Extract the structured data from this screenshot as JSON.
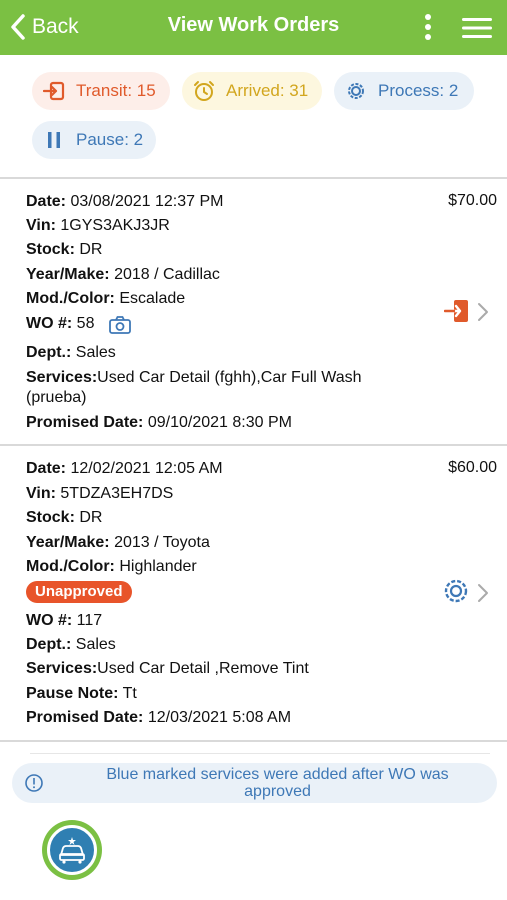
{
  "header": {
    "back_label": "Back",
    "title": "View Work Orders"
  },
  "status": {
    "transit": "Transit: 15",
    "arrived": "Arrived: 31",
    "process": "Process: 2",
    "pause": "Pause: 2"
  },
  "orders": [
    {
      "date_label": "Date:",
      "date": "03/08/2021 12:37 PM",
      "price": "$70.00",
      "vin_label": "Vin:",
      "vin": "1GYS3AKJ3JR",
      "stock_label": "Stock:",
      "stock": "DR",
      "yearmake_label": "Year/Make:",
      "yearmake": "2018 / Cadillac",
      "modcolor_label": "Mod./Color:",
      "modcolor": "Escalade",
      "wo_label": "WO #:",
      "wo": "58",
      "dept_label": "Dept.:",
      "dept": "Sales",
      "services_label": "Services:",
      "services_line1": "Used Car Detail (fghh),Car Full Wash",
      "services_line2": "(prueba)",
      "promised_label": "Promised Date:",
      "promised": "09/10/2021 8:30 PM",
      "status_icon": "transit-icon"
    },
    {
      "date_label": "Date:",
      "date": "12/02/2021 12:05 AM",
      "price": "$60.00",
      "vin_label": "Vin:",
      "vin": "5TDZA3EH7DS",
      "stock_label": "Stock:",
      "stock": "DR",
      "yearmake_label": "Year/Make:",
      "yearmake": "2013 / Toyota",
      "modcolor_label": "Mod./Color:",
      "modcolor": "Highlander",
      "badge": "Unapproved",
      "wo_label": "WO #:",
      "wo": "117",
      "dept_label": "Dept.:",
      "dept": "Sales",
      "services_label": "Services:",
      "services_line1": "Used Car Detail ,Remove Tint",
      "pause_label": "Pause Note:",
      "pause_note": "Tt",
      "promised_label": "Promised Date:",
      "promised": "12/03/2021 5:08 AM",
      "status_icon": "process-icon"
    }
  ],
  "note": {
    "text": "Blue marked services were added after WO was approved"
  },
  "colors": {
    "header": "#7bc043",
    "transit": "#e05a2b",
    "arrived": "#d2a61e",
    "process": "#3e78b6",
    "badge": "#e8542a"
  }
}
